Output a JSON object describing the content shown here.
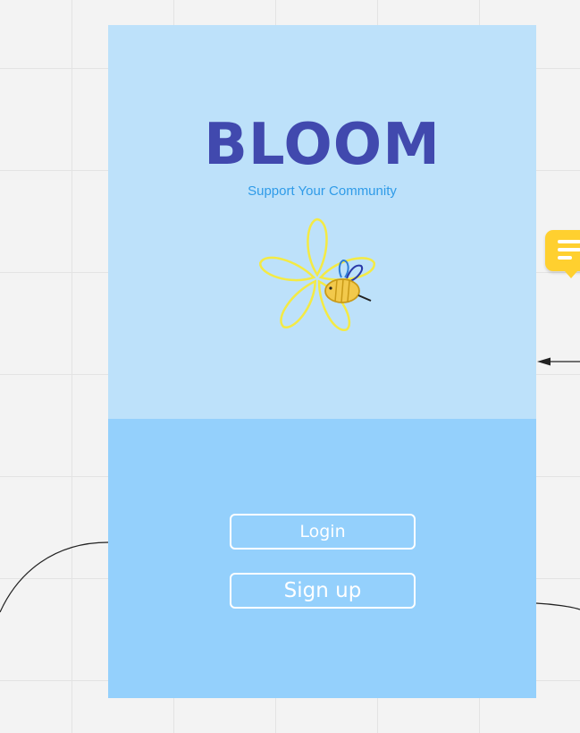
{
  "app": {
    "logo_text": "BLOOM",
    "tagline": "Support Your Community"
  },
  "actions": {
    "login_label": "Login",
    "signup_label": "Sign up"
  },
  "colors": {
    "canvas": "#f3f3f3",
    "frame_top": "#bde1fa",
    "frame_bottom": "#94d0fc",
    "logo": "#4149ae",
    "tagline": "#2f9be8",
    "comment": "#ffd02f",
    "flower_outline": "#f4ea44",
    "bee_body": "#f2c94c"
  },
  "icons": {
    "illustration": "flower-with-bee-icon",
    "comment": "comment-icon"
  }
}
